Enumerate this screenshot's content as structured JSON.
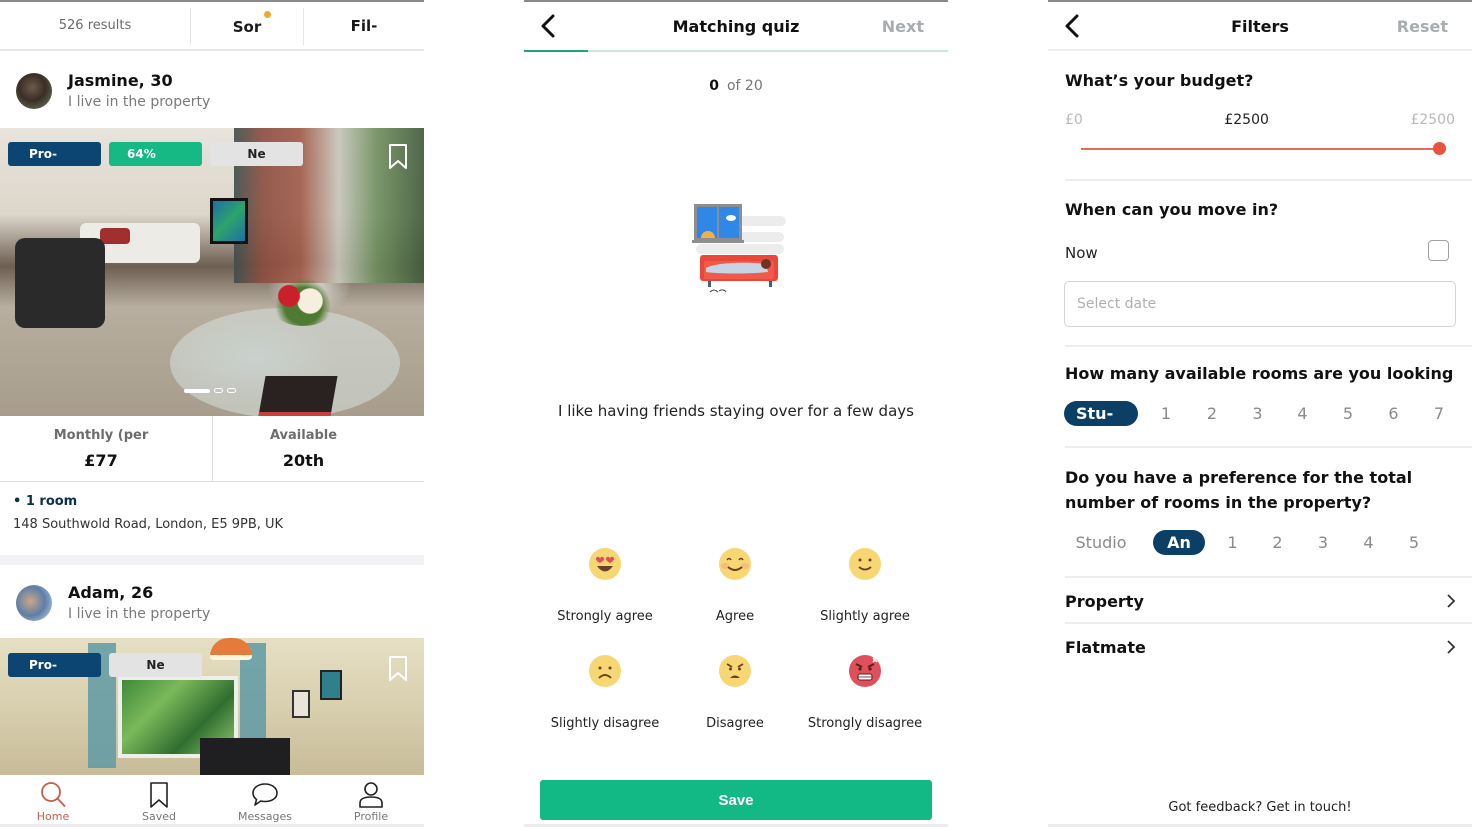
{
  "search_screen": {
    "results_count": "526 results",
    "sort_label": "Sor",
    "filter_label": "Fil-",
    "listings": [
      {
        "user_name": "Jasmine, 30",
        "user_subtitle": "I live in the property",
        "badges": [
          "Pro-",
          "64%",
          "Ne"
        ],
        "photo_index": 1,
        "photo_count": 3,
        "price_label": "Monthly (per",
        "price_value": "£77",
        "available_label": "Available",
        "available_value": "20th",
        "rooms": "• 1 room",
        "address": "148 Southwold Road, London, E5 9PB, UK"
      },
      {
        "user_name": "Adam, 26",
        "user_subtitle": "I live in the property",
        "badges": [
          "Pro-",
          "Ne"
        ]
      }
    ],
    "bottom_nav": [
      {
        "label": "Home",
        "icon": "search-icon",
        "active": true
      },
      {
        "label": "Saved",
        "icon": "bookmark-icon",
        "active": false
      },
      {
        "label": "Messages",
        "icon": "chat-bubble-icon",
        "active": false
      },
      {
        "label": "Profile",
        "icon": "person-icon",
        "active": false
      }
    ]
  },
  "quiz_screen": {
    "title": "Matching quiz",
    "next_label": "Next",
    "progress_current": "0",
    "progress_total": "of 20",
    "progress_fraction": 0.15,
    "illustration": "person-sleeping-on-sofa-illustration",
    "question": "I like having friends staying over for a few days",
    "answers": [
      {
        "label": "Strongly agree",
        "icon": "heart-eyes-emoji-icon"
      },
      {
        "label": "Agree",
        "icon": "smiling-blush-emoji-icon"
      },
      {
        "label": "Slightly agree",
        "icon": "slight-smile-emoji-icon"
      },
      {
        "label": "Slightly disagree",
        "icon": "slight-frown-emoji-icon"
      },
      {
        "label": "Disagree",
        "icon": "angry-emoji-icon"
      },
      {
        "label": "Strongly disagree",
        "icon": "furious-emoji-icon"
      }
    ],
    "save_label": "Save",
    "colors": {
      "accent": "#13b985",
      "emoji": "#f7d774",
      "furious": "#e0505a"
    }
  },
  "filters_screen": {
    "title": "Filters",
    "reset_label": "Reset",
    "budget": {
      "title": "What’s your budget?",
      "min_label": "£0",
      "current_label": "£2500",
      "max_label": "£2500",
      "value_fraction": 1.0
    },
    "move_in": {
      "title": "When can you move in?",
      "now_label": "Now",
      "now_checked": false,
      "date_placeholder": "Select date",
      "date_value": ""
    },
    "available_rooms": {
      "title": "How many available rooms are you looking",
      "options": [
        "Stu-",
        "1",
        "2",
        "3",
        "4",
        "5",
        "6",
        "7"
      ],
      "selected": "Stu-"
    },
    "total_rooms": {
      "title": "Do you have a preference for the total number of rooms in the property?",
      "options": [
        "Studio",
        "An",
        "1",
        "2",
        "3",
        "4",
        "5"
      ],
      "selected": "An"
    },
    "nav_rows": [
      {
        "label": "Property"
      },
      {
        "label": "Flatmate"
      }
    ],
    "feedback_text": "Got feedback? Get in touch!",
    "colors": {
      "slider": "#e8523e",
      "chip_selected": "#0c3f66"
    }
  }
}
